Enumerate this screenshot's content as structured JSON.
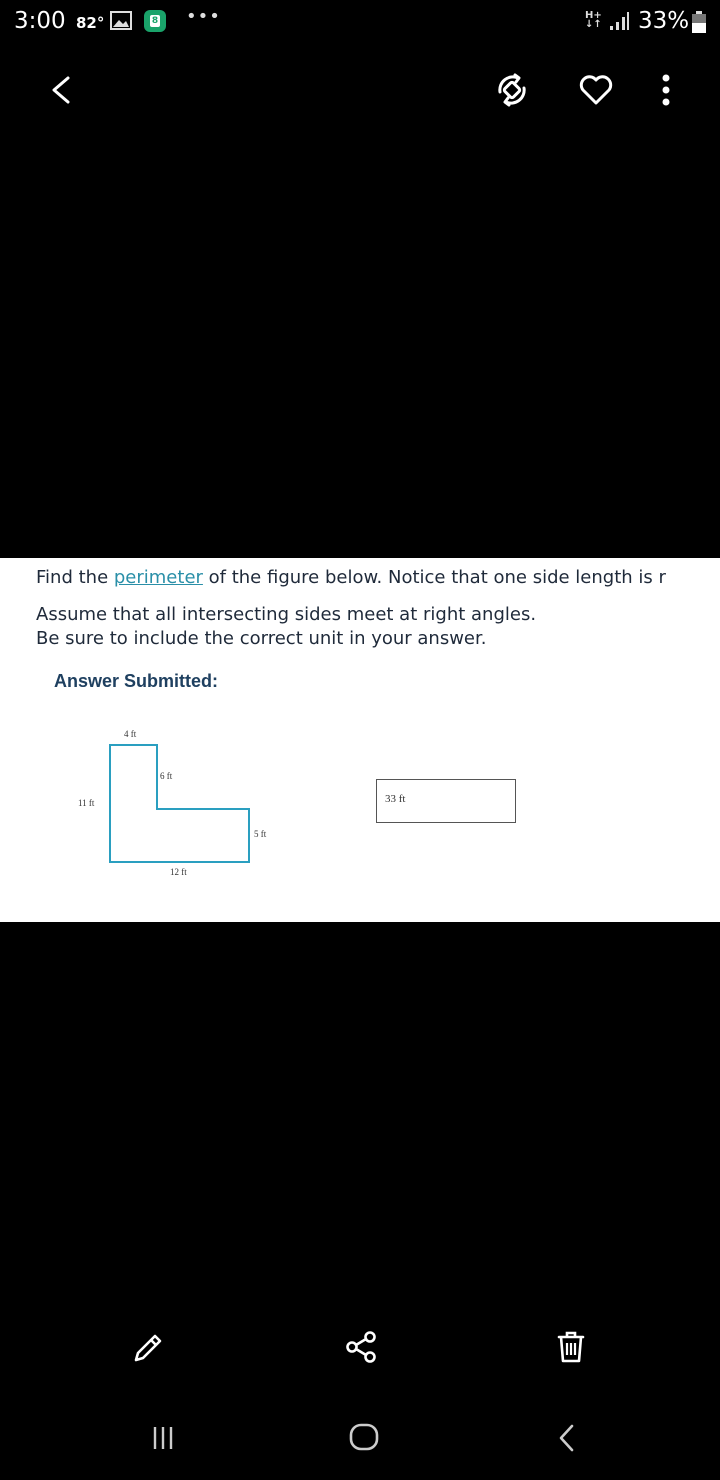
{
  "status_bar": {
    "time": "3:00",
    "temperature": "82°",
    "more": "•••",
    "app_badge": "8",
    "network": "H+",
    "network_arrows": "↓↑",
    "battery": "33%"
  },
  "toolbar": {
    "back_icon": "chevron-left-icon",
    "rotate_icon": "auto-rotate-icon",
    "favorite_icon": "heart-icon",
    "more_icon": "more-vertical-icon"
  },
  "question": {
    "line1_before": "Find the ",
    "line1_link": "perimeter",
    "line1_after": " of the figure below. Notice that one side length is r",
    "line2": "Assume that all intersecting sides meet at right angles.",
    "line3": "Be sure to include the correct unit in your answer.",
    "answer_heading": "Answer Submitted:"
  },
  "figure": {
    "label_top": "4 ft",
    "label_inner": "6 ft",
    "label_left": "11 ft",
    "label_right": "5 ft",
    "label_bottom": "12 ft",
    "stroke_color": "#2a9fc0"
  },
  "answer": {
    "value": "33 ft"
  },
  "actions": {
    "edit_icon": "pencil-icon",
    "share_icon": "share-icon",
    "delete_icon": "trash-icon"
  },
  "navigation": {
    "recents_icon": "recents-icon",
    "home_icon": "home-icon",
    "back_icon": "back-icon"
  }
}
